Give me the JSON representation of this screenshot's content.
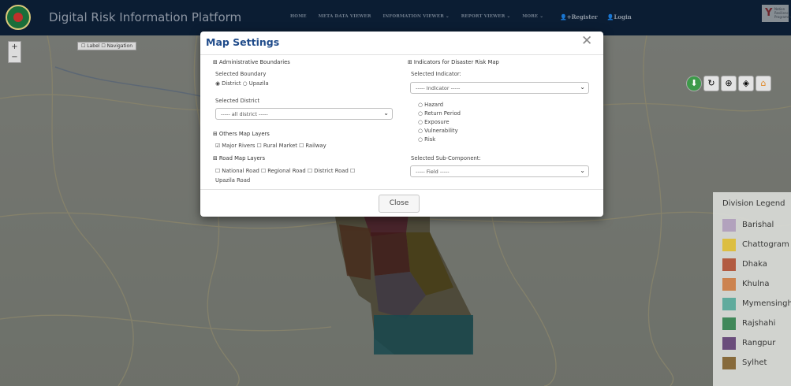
{
  "header": {
    "app_title": "Digital Risk Information Platform",
    "nav": [
      "HOME",
      "META DATA VIEWER",
      "INFORMATION VIEWER ⌄",
      "REPORT VIEWER ⌄",
      "MORE ⌄"
    ],
    "register": "Register",
    "login": "Login"
  },
  "map": {
    "zoom_in": "+",
    "zoom_out": "−",
    "label_toggle": "☐ Label ☐ Navigation"
  },
  "modal": {
    "title": "Map Settings",
    "close_x": "✕",
    "admin_header": "⊞ Administrative Boundaries",
    "selected_boundary_label": "Selected Boundary",
    "boundary_options": "◉ District ○ Upazila",
    "selected_district_label": "Selected District",
    "district_value": "----- all district -----",
    "others_header": "⊞ Others Map Layers",
    "others_options": "☑ Major Rivers ☐ Rural Market ☐ Railway",
    "road_header": "⊞ Road Map Layers",
    "road_options_1": "☐ National Road ☐ Regional Road ☐ District Road ☐",
    "road_options_2": "Upazila Road",
    "indicators_header": "⊞ Indicators for Disaster Risk Map",
    "selected_indicator_label": "Selected Indicator:",
    "indicator_value": "----- Indicator -----",
    "indicator_radios": [
      "○ Hazard",
      "○ Return Period",
      "○ Exposure",
      "○ Vulnerability",
      "○ Risk"
    ],
    "sub_component_label": "Selected Sub-Component:",
    "sub_component_value": "----- Field -----",
    "close_button": "Close"
  },
  "legend": {
    "title": "Division Legend",
    "items": [
      {
        "name": "Barishal",
        "color": "#b8a6c4"
      },
      {
        "name": "Chattogram",
        "color": "#e6c53e"
      },
      {
        "name": "Dhaka",
        "color": "#b85a3e"
      },
      {
        "name": "Khulna",
        "color": "#d4854d"
      },
      {
        "name": "Mymensingh",
        "color": "#5fb0a2"
      },
      {
        "name": "Rajshahi",
        "color": "#3d8a58"
      },
      {
        "name": "Rangpur",
        "color": "#6a4a7d"
      },
      {
        "name": "Sylhet",
        "color": "#8a6a38"
      }
    ]
  }
}
